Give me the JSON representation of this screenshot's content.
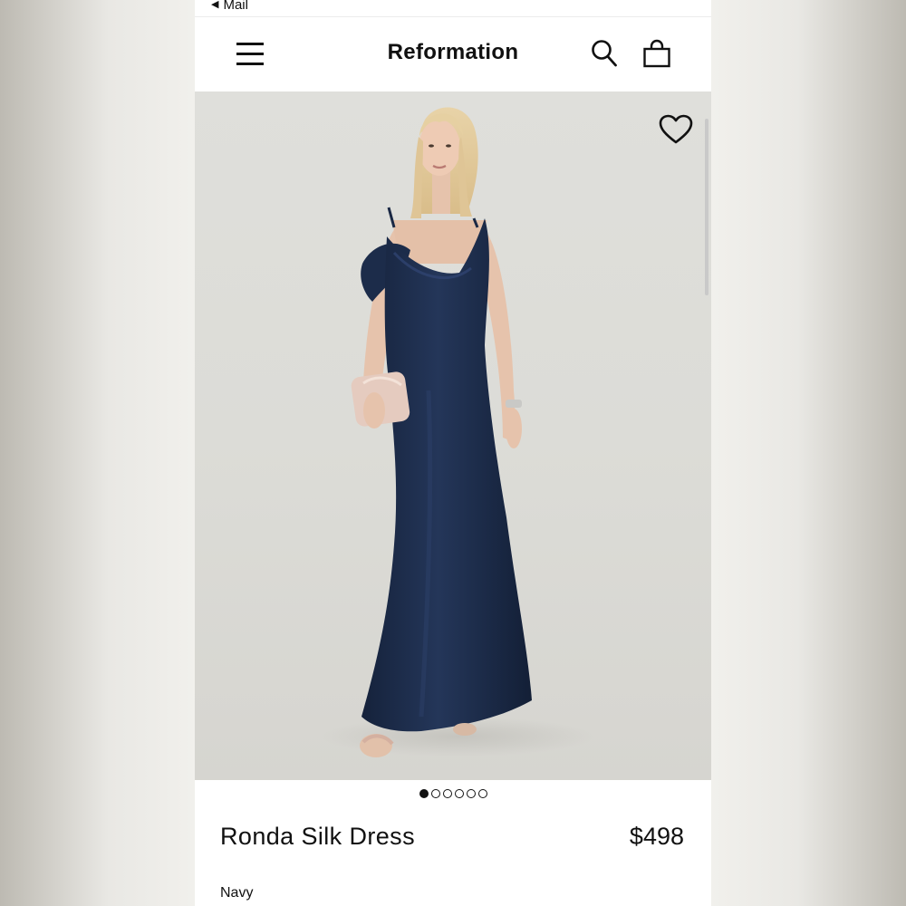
{
  "status_bar": {
    "back_label": "Mail"
  },
  "header": {
    "brand": "Reformation"
  },
  "icons": {
    "menu": "hamburger-menu-icon",
    "search": "search-icon",
    "bag": "shopping-bag-icon",
    "wishlist": "heart-icon",
    "back": "back-triangle-icon"
  },
  "gallery": {
    "image_count": 6,
    "active_index": 0
  },
  "product": {
    "name": "Ronda Silk Dress",
    "price": "$498",
    "color": "Navy"
  },
  "colors": {
    "dress": "#1c2c4a",
    "background": "#dcdcd7",
    "text": "#111111"
  }
}
